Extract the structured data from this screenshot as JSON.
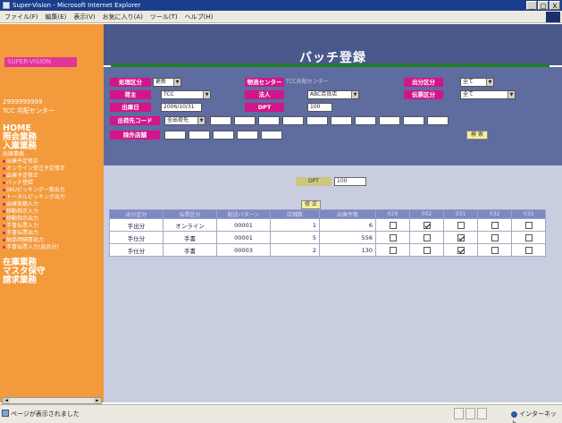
{
  "window": {
    "title": "Super-Vision - Microsoft Internet Explorer",
    "controls": [
      "_",
      "□",
      "X"
    ]
  },
  "menu": {
    "items": [
      "ファイル(F)",
      "編集(E)",
      "表示(V)",
      "お気に入り(A)",
      "ツール(T)",
      "ヘルプ(H)"
    ]
  },
  "sidebar": {
    "logo_text": "SUPER-VISION",
    "user_id": "2999999999",
    "user_center": "TCC 共配センター",
    "nav": [
      {
        "label": "HOME",
        "type": "big"
      },
      {
        "label": "照会業務",
        "type": "big"
      },
      {
        "label": "入庫業務",
        "type": "big"
      },
      {
        "label": "出庫業務",
        "type": "sub-header"
      },
      {
        "label": "出庫予定修正",
        "type": "sub"
      },
      {
        "label": "オンライン受注予定修正",
        "type": "sub"
      },
      {
        "label": "出庫予定修正",
        "type": "sub"
      },
      {
        "label": "バッチ登録",
        "type": "sub"
      },
      {
        "label": "SKUピッキング一覧出力",
        "type": "sub"
      },
      {
        "label": "トータルピッキング出力",
        "type": "sub"
      },
      {
        "label": "出庫実績入力",
        "type": "sub"
      },
      {
        "label": "移動指示入力",
        "type": "sub"
      },
      {
        "label": "移動指示出力",
        "type": "sub"
      },
      {
        "label": "手書伝票入力",
        "type": "sub"
      },
      {
        "label": "手書伝票出力",
        "type": "sub"
      },
      {
        "label": "納品明細書出力",
        "type": "sub"
      },
      {
        "label": "手書伝票入力(返品分)",
        "type": "sub"
      },
      {
        "label": "在庫業務",
        "type": "big"
      },
      {
        "label": "マスタ保守",
        "type": "big"
      },
      {
        "label": "請求業務",
        "type": "big"
      }
    ],
    "scroll_left": "◄",
    "scroll_right": "►"
  },
  "page": {
    "title": "バッチ登録"
  },
  "form": {
    "shori_kubun_label": "処理区分",
    "shori_kubun_value": "更新",
    "butsuryu_center_label": "物流センター",
    "butsuryu_center_value": "TCC共配センター",
    "hikiate_kubun_label": "出分区分",
    "hikiate_kubun_value": "全て",
    "ninushi_label": "荷主",
    "ninushi_value": "TCC",
    "hojin_label": "法人",
    "hojin_value": "ABC百貨店",
    "denpyo_kubun_label": "伝票区分",
    "denpyo_kubun_value": "全て",
    "shukko_bi_label": "出庫日",
    "shukko_bi_value": "2006/10/31",
    "dpt_label": "DPT",
    "dpt_value": "100",
    "shukkasaki_code_label": "出荷先コード",
    "shukkasaki_code_value": "全出荷先",
    "jogai_label": "除外店舗",
    "search_button": "検 索"
  },
  "results": {
    "dpt_label": "DPT",
    "dpt_value": "100",
    "update_button": "修 正",
    "columns": [
      "出分区分",
      "伝票区分",
      "配送バターン",
      "店舗数",
      "出庫件数",
      "029",
      "002",
      "031",
      "032",
      "033"
    ],
    "rows": [
      {
        "hikiate": "手出分",
        "denpyo": "オンライン",
        "pattern": "00001",
        "stores": "1",
        "count": "6",
        "checks": [
          false,
          true,
          false,
          false,
          false
        ]
      },
      {
        "hikiate": "手仕分",
        "denpyo": "手書",
        "pattern": "00001",
        "stores": "5",
        "count": "556",
        "checks": [
          false,
          false,
          true,
          false,
          false
        ]
      },
      {
        "hikiate": "手仕分",
        "denpyo": "手書",
        "pattern": "00003",
        "stores": "2",
        "count": "130",
        "checks": [
          false,
          false,
          true,
          false,
          false
        ]
      }
    ]
  },
  "status": {
    "text": "ページが表示されました",
    "zone": "インターネット"
  },
  "colors": {
    "sidebar": "#f39a3c",
    "header": "#4a588c",
    "label": "#d4148a",
    "accent_green": "#1f7e2c"
  }
}
